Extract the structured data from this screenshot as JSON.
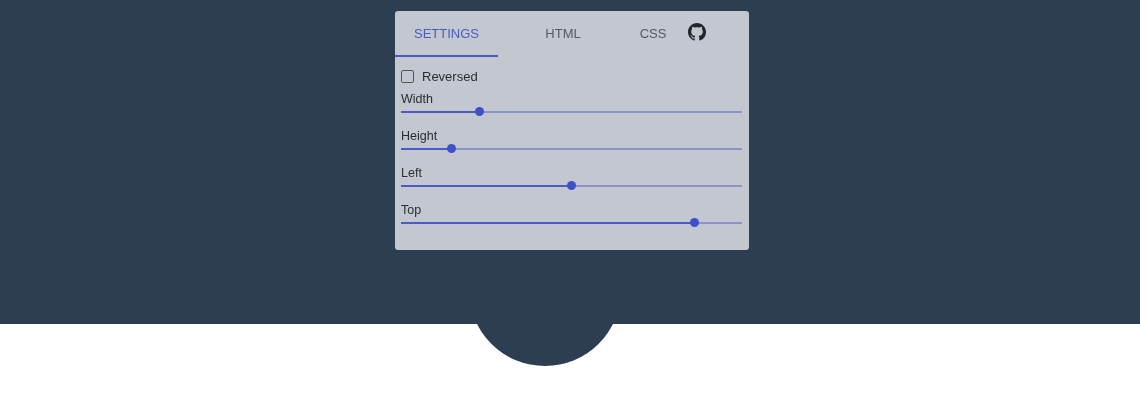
{
  "tabs": [
    {
      "label": "SETTINGS",
      "selected": true
    },
    {
      "label": "HTML",
      "selected": false
    },
    {
      "label": "CSS",
      "selected": false
    }
  ],
  "reversed": {
    "label": "Reversed",
    "checked": false
  },
  "sliders": [
    {
      "label": "Width",
      "level": 0.23
    },
    {
      "label": "Height",
      "level": 0.147
    },
    {
      "label": "Left",
      "level": 0.5
    },
    {
      "label": "Top",
      "level": 0.86
    }
  ]
}
